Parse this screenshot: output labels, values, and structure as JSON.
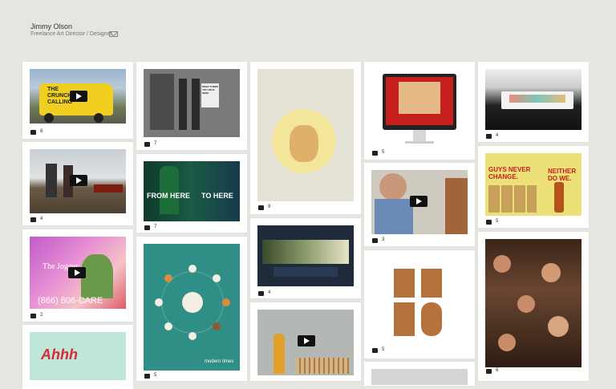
{
  "header": {
    "name": "Jimmy Olson",
    "role": "Freelance Art Director / Designer"
  },
  "cards": {
    "c1": {
      "count": "6",
      "text": "THE CRUNCH IS CALLING"
    },
    "c2": {
      "count": "4"
    },
    "c3": {
      "count": "2",
      "title": "The Jogger",
      "phone": "(866) 606-CARE"
    },
    "c4": {
      "count": "",
      "text": "Ahhh"
    },
    "c5": {
      "count": "7",
      "text": "WHAT TURNS YOU ON IS HERE"
    },
    "c6": {
      "count": "7",
      "left": "FROM HERE",
      "right": "TO HERE"
    },
    "c7": {
      "count": "5",
      "caption": "modern times"
    },
    "c8": {
      "count": "9"
    },
    "c9": {
      "count": "4"
    },
    "c10": {
      "count": "4"
    },
    "c11": {
      "count": "5"
    },
    "c12": {
      "count": "3"
    },
    "c13": {
      "count": "5"
    },
    "c14": {
      "count": ""
    },
    "c15": {
      "count": "4"
    },
    "c16": {
      "count": "5",
      "left": "GUYS NEVER CHANGE.",
      "right": "NEITHER DO WE."
    },
    "c17": {
      "count": "6"
    }
  },
  "colors": {
    "bg": "#e6e5df",
    "card": "#ffffff"
  }
}
